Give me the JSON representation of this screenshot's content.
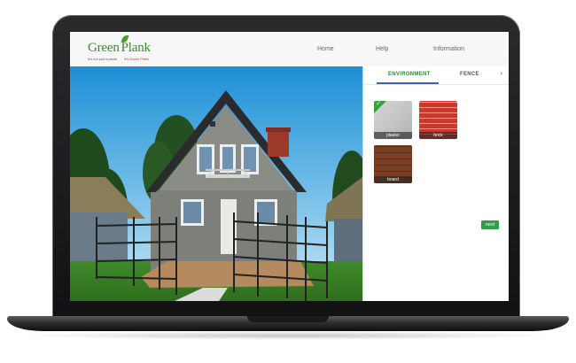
{
  "brand": {
    "name_part1": "Green",
    "name_part2": "Plank",
    "tagline_left": "It's not just a plank",
    "tagline_right": "It's Green Plank"
  },
  "nav": {
    "home": "Home",
    "help": "Help",
    "information": "Information"
  },
  "panel": {
    "tabs": [
      "ENVIRONMENT",
      "FENCE"
    ],
    "active_tab": "ENVIRONMENT",
    "more_arrow": "›",
    "materials": [
      {
        "label": "plaster",
        "selected": true
      },
      {
        "label": "brick",
        "selected": false
      },
      {
        "label": "board",
        "selected": false
      }
    ],
    "next_label": "next"
  },
  "colors": {
    "brand_green": "#3d8a2a",
    "accent_blue": "#2a6ab0",
    "next_green": "#2fa04a"
  }
}
